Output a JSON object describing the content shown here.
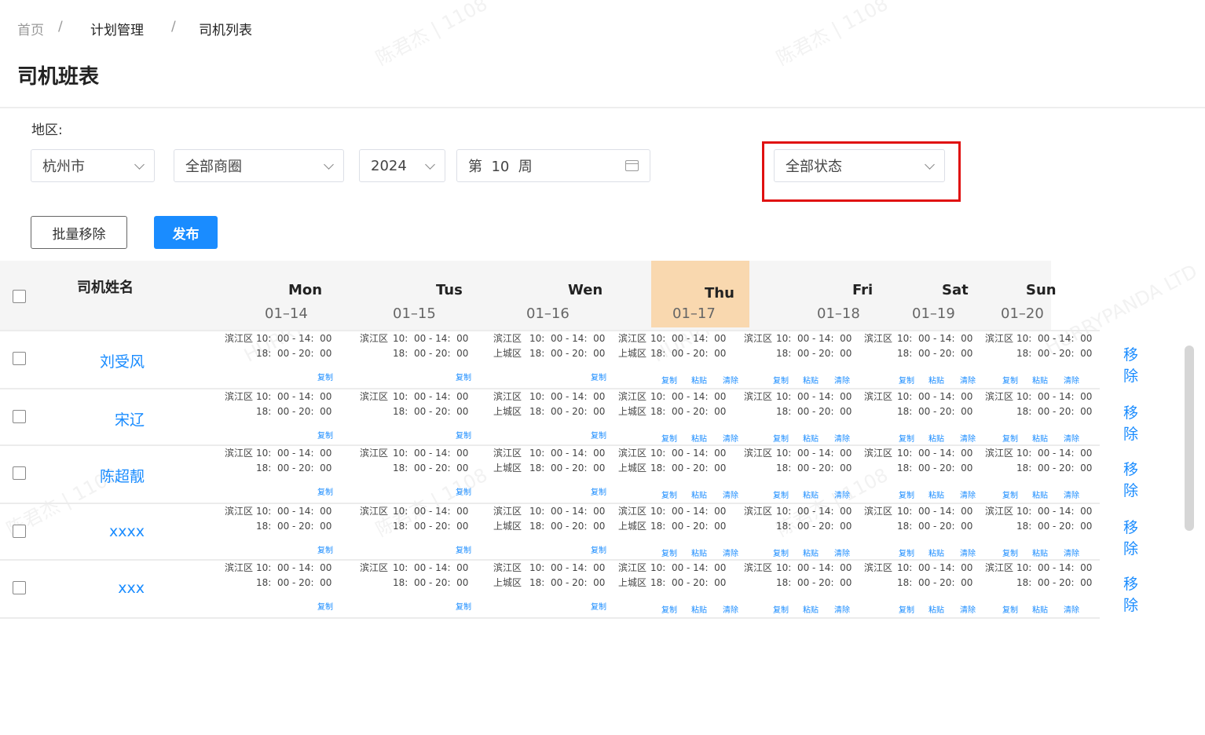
{
  "breadcrumb": {
    "home": "首页",
    "sep": "/",
    "plan": "计划管理",
    "current": "司机列表"
  },
  "page_title": "司机班表",
  "filters": {
    "region_label": "地区:",
    "city": "杭州市",
    "district": "全部商圈",
    "year": "2024",
    "week": "第  10  周",
    "status": "全部状态"
  },
  "buttons": {
    "batch_remove": "批量移除",
    "publish": "发布"
  },
  "table": {
    "name_header": "司机姓名",
    "days": [
      {
        "day": "Mon",
        "date": "01–14"
      },
      {
        "day": "Tus",
        "date": "01–15"
      },
      {
        "day": "Wen",
        "date": "01–16"
      },
      {
        "day": "Thu",
        "date": "01–17"
      },
      {
        "day": "Fri",
        "date": "01–18"
      },
      {
        "day": "Sat",
        "date": "01–19"
      },
      {
        "day": "Sun",
        "date": "01–20"
      }
    ],
    "drivers": [
      "刘受风",
      "宋辽",
      "陈超靓",
      "xxxx",
      "xxx"
    ],
    "remove_label": "移除",
    "zone1": "滨江区",
    "zone2": "上城区",
    "slot1": "10:  00 - 14:  00",
    "slot2": "18:  00 - 20:  00",
    "copy": "复制",
    "paste": "粘贴",
    "clear": "清除"
  },
  "colors": {
    "primary": "#1a8cff",
    "highlight": "#e01010",
    "today": "#f9d8af"
  }
}
